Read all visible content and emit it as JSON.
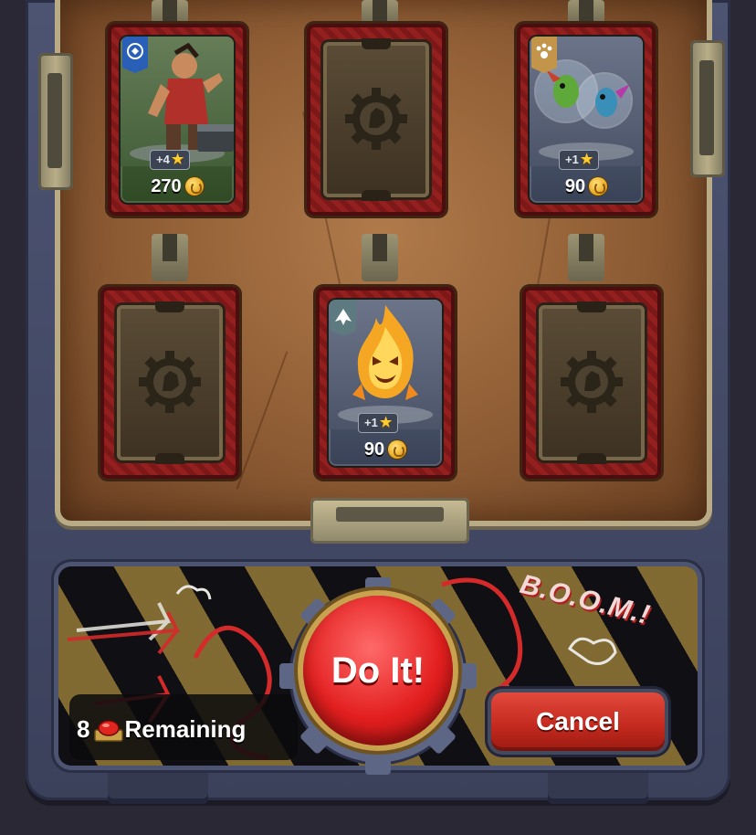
{
  "slots": [
    {
      "state": "card",
      "level": "+4",
      "price": "270",
      "theme": "green",
      "banner_icon": "alliance-lion-icon",
      "art": "warrior-with-chest"
    },
    {
      "state": "empty"
    },
    {
      "state": "card",
      "level": "+1",
      "price": "90",
      "theme": "slate",
      "banner_icon": "paw-icon",
      "art": "murlocs-in-bubbles"
    },
    {
      "state": "empty"
    },
    {
      "state": "card",
      "level": "+1",
      "price": "90",
      "theme": "slate",
      "banner_icon": "fire-elemental-banner-icon",
      "art": "fire-elemental"
    },
    {
      "state": "empty"
    }
  ],
  "remaining": {
    "count": "8",
    "label": "Remaining"
  },
  "do_it_label": "Do It!",
  "cancel_label": "Cancel",
  "graffiti_text": "B.O.O.M.!",
  "colors": {
    "button_red": "#e31f1f",
    "coin_gold": "#e6a21a",
    "case_blue": "#4d5472"
  }
}
